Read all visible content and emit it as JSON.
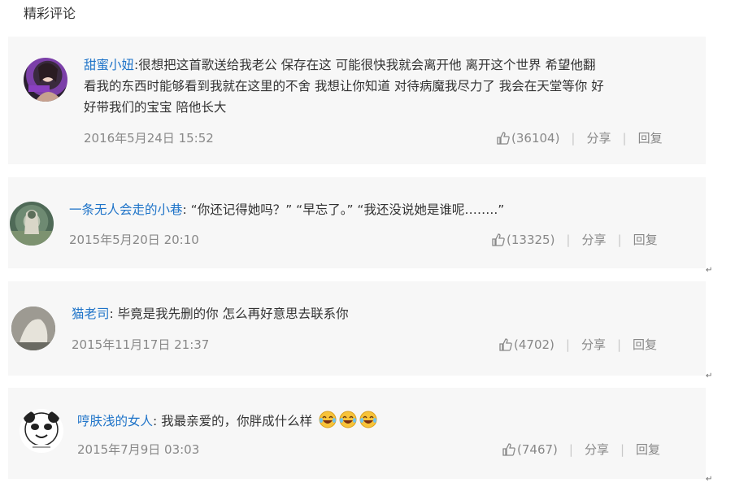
{
  "section_title": "精彩评论",
  "comments": [
    {
      "username": "甜蜜小妞",
      "separator": ":",
      "text_lines": [
        "很想把这首歌送给我老公 保存在这 可能很快我就会离开他 离开这个世界 希望他翻",
        "看我的东西时能够看到我就在这里的不舍 我想让你知道 对待病魔我尽力了 我会在天堂等你 好",
        "好带我们的宝宝 陪他长大"
      ],
      "time": "2016年5月24日 15:52",
      "likes": "(36104)",
      "share": "分享",
      "reply": "回复"
    },
    {
      "username": "一条无人会走的小巷",
      "separator": ":",
      "text": " “你还记得她吗？” “早忘了。” “我还没说她是谁呢……..”",
      "time": "2015年5月20日 20:10",
      "likes": "(13325)",
      "share": "分享",
      "reply": "回复"
    },
    {
      "username": "猫老司",
      "separator": ":",
      "text": " 毕竟是我先删的你 怎么再好意思去联系你",
      "time": "2015年11月17日 21:37",
      "likes": "(4702)",
      "share": "分享",
      "reply": "回复"
    },
    {
      "username": "哼肤浅的女人",
      "separator": ":",
      "text": " 我最亲爱的，你胖成什么样",
      "emoji_count": 3,
      "emoji_name": "laugh-cry-emoji",
      "time": "2015年7月9日 03:03",
      "likes": "(7467)",
      "share": "分享",
      "reply": "回复"
    }
  ],
  "separator_char": "|",
  "paragraph_mark": "↵",
  "colors": {
    "username": "#1e73c8",
    "card_bg": "#f7f7f7",
    "meta": "#888888",
    "text": "#333333"
  }
}
